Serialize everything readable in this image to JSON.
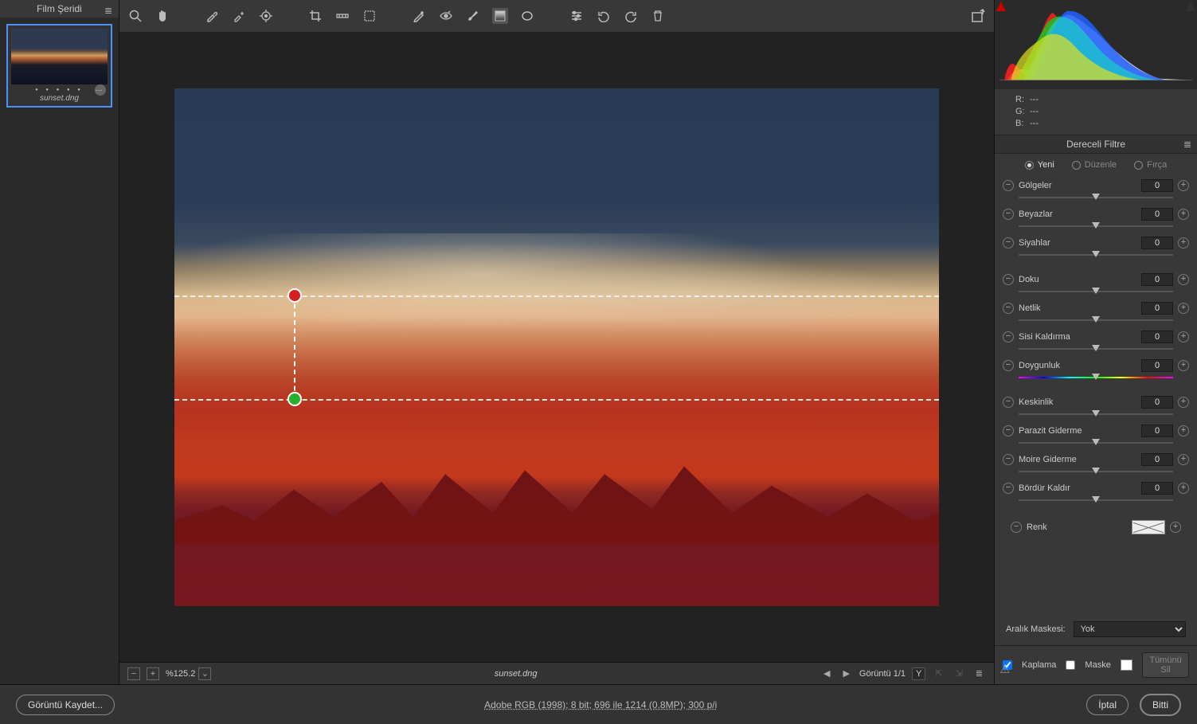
{
  "filmstrip": {
    "title": "Film Şeridi",
    "thumb_name": "sunset.dng"
  },
  "toolbar_icons": [
    "zoom",
    "hand",
    "white-balance",
    "color-sampler",
    "targeted-adjust",
    "crop",
    "straighten",
    "transform",
    "spot",
    "redeye",
    "brush",
    "gradient-rect",
    "gradient-radial",
    "list",
    "rotate-ccw",
    "rotate-cw",
    "trash"
  ],
  "canvas": {
    "filename": "sunset.dng"
  },
  "footer": {
    "zoom_value": "%125.2",
    "image_counter": "Görüntü 1/1",
    "compare_key": "Y"
  },
  "histogram": {
    "rgb": {
      "r_label": "R:",
      "g_label": "G:",
      "b_label": "B:",
      "r_val": "---",
      "g_val": "---",
      "b_val": "---"
    }
  },
  "panel": {
    "title": "Dereceli Filtre",
    "modes": {
      "new": "Yeni",
      "edit": "Düzenle",
      "brush": "Fırça"
    },
    "sliders": [
      {
        "key": "golgeler",
        "label": "Gölgeler",
        "val": "0"
      },
      {
        "key": "beyazlar",
        "label": "Beyazlar",
        "val": "0"
      },
      {
        "key": "siyahlar",
        "label": "Siyahlar",
        "val": "0"
      }
    ],
    "sliders2": [
      {
        "key": "doku",
        "label": "Doku",
        "val": "0"
      },
      {
        "key": "netlik",
        "label": "Netlik",
        "val": "0"
      },
      {
        "key": "sisi",
        "label": "Sisi Kaldırma",
        "val": "0"
      },
      {
        "key": "doygunluk",
        "label": "Doygunluk",
        "val": "0"
      }
    ],
    "sliders3": [
      {
        "key": "keskinlik",
        "label": "Keskinlik",
        "val": "0"
      },
      {
        "key": "parazit",
        "label": "Parazit Giderme",
        "val": "0"
      },
      {
        "key": "moire",
        "label": "Moire Giderme",
        "val": "0"
      },
      {
        "key": "bordur",
        "label": "Bördür Kaldır",
        "val": "0"
      }
    ],
    "color_label": "Renk",
    "range_mask_label": "Aralık Maskesi:",
    "range_mask_value": "Yok",
    "overlay_label": "Kaplama",
    "mask_label": "Maske",
    "delete_all": "Tümünü Sil"
  },
  "status": {
    "save_image": "Görüntü Kaydet...",
    "info": "Adobe RGB (1998); 8 bit; 696 ile 1214 (0.8MP); 300 p/i",
    "cancel": "İptal",
    "done": "Bitti"
  }
}
